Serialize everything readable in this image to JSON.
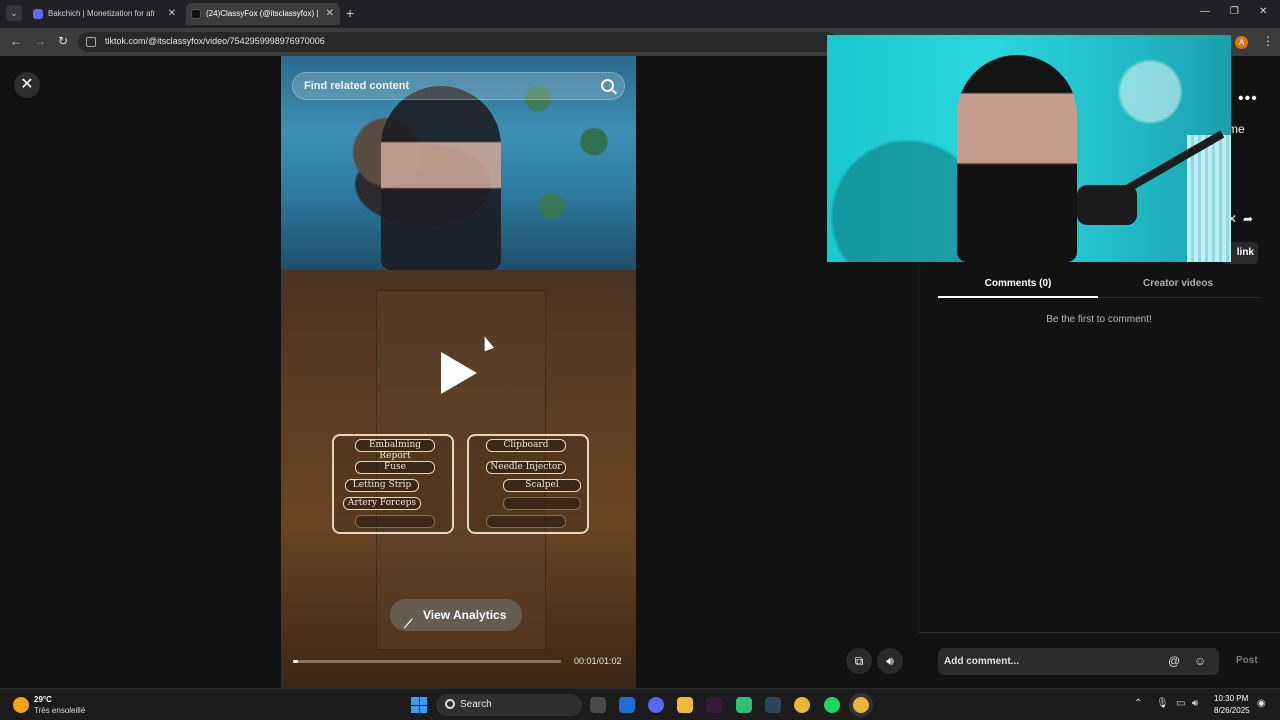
{
  "browser": {
    "tabs": [
      {
        "title": "Bakchich | Monetization for afr",
        "active": false
      },
      {
        "title": "(24)ClassyFox (@itsclassyfox) |",
        "active": true
      }
    ],
    "new_tab": "+",
    "url": "tiktok.com/@itsclassyfox/video/7542959998976970006",
    "profile_initial": "A"
  },
  "video": {
    "search_placeholder": "Find related content",
    "game_menu": {
      "left": [
        "Embalming Report",
        "Fuse",
        "Letting Strip",
        "Artery Forceps",
        ""
      ],
      "right": [
        "Clipboard",
        "Needle Injector",
        "Scalpel",
        "",
        ""
      ]
    },
    "analytics_label": "View Analytics",
    "time": "00:01/01:02",
    "progress": 0.02
  },
  "panel": {
    "partial_text": "me",
    "copy_link": "link",
    "tabs": [
      "Comments (0)",
      "Creator videos"
    ],
    "empty_comments": "Be the first to comment!",
    "comment_placeholder": "Add comment...",
    "post": "Post"
  },
  "taskbar": {
    "weather_temp": "29°C",
    "weather_desc": "Très ensoleillé",
    "search": "Search",
    "time": "10:30 PM",
    "date": "8/26/2025"
  },
  "icons": [
    "close-icon",
    "search-icon",
    "play-icon",
    "analytics-icon",
    "more-icon",
    "share-icon",
    "mention-icon",
    "emoji-icon",
    "volume-icon",
    "pip-icon"
  ]
}
